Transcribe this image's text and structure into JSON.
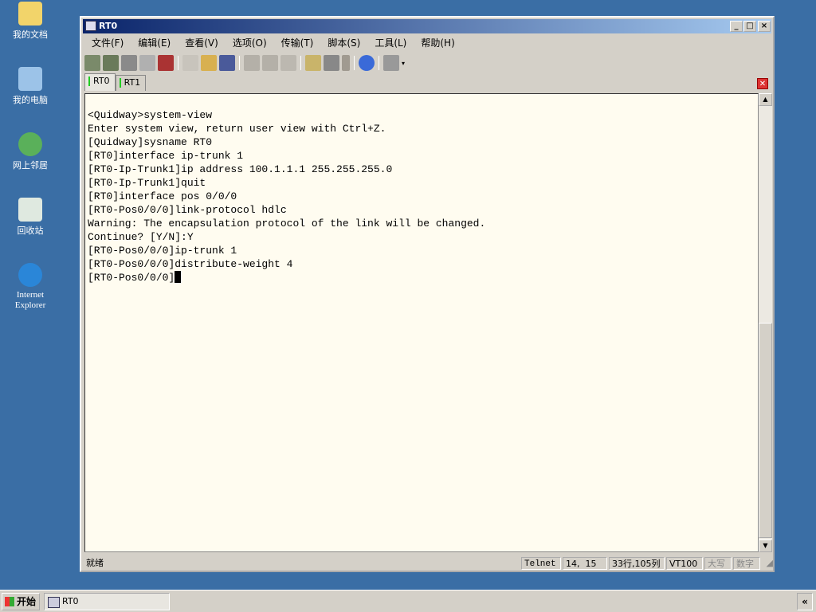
{
  "desktop": {
    "icons": [
      {
        "label": "我的文档"
      },
      {
        "label": "我的电脑"
      },
      {
        "label": "网上邻居"
      },
      {
        "label": "回收站"
      },
      {
        "label": "Internet Explorer"
      }
    ]
  },
  "window": {
    "title": "RT0",
    "menu": [
      "文件(F)",
      "编辑(E)",
      "查看(V)",
      "选项(O)",
      "传输(T)",
      "脚本(S)",
      "工具(L)",
      "帮助(H)"
    ],
    "toolbar_icons": [
      "connect-icon",
      "quick-connect-icon",
      "connect-tab-icon",
      "reconnect-icon",
      "disconnect-icon",
      "copy-icon",
      "paste-icon",
      "find-icon",
      "print-icon",
      "print-setup-icon",
      "print-screen-icon",
      "session-options-icon",
      "global-options-icon",
      "keymap-icon",
      "help-icon",
      "extra-icon"
    ],
    "tabs": [
      {
        "label": "RT0",
        "active": true
      },
      {
        "label": "RT1",
        "active": false
      }
    ],
    "terminal_lines": [
      "<Quidway>system-view",
      "Enter system view, return user view with Ctrl+Z.",
      "[Quidway]sysname RT0",
      "[RT0]interface ip-trunk 1",
      "[RT0-Ip-Trunk1]ip address 100.1.1.1 255.255.255.0",
      "[RT0-Ip-Trunk1]quit",
      "[RT0]interface pos 0/0/0",
      "[RT0-Pos0/0/0]link-protocol hdlc",
      "Warning: The encapsulation protocol of the link will be changed.",
      "Continue? [Y/N]:Y",
      "[RT0-Pos0/0/0]ip-trunk 1",
      "[RT0-Pos0/0/0]distribute-weight 4"
    ],
    "prompt": "[RT0-Pos0/0/0]",
    "status": {
      "ready": "就绪",
      "protocol": "Telnet",
      "cursor_pos": "14,  15",
      "size": "33行,105列",
      "emulation": "VT100",
      "caps": "大写",
      "num": "数字"
    }
  },
  "taskbar": {
    "start": "开始",
    "task": "RT0",
    "tray_toggle": "«"
  }
}
